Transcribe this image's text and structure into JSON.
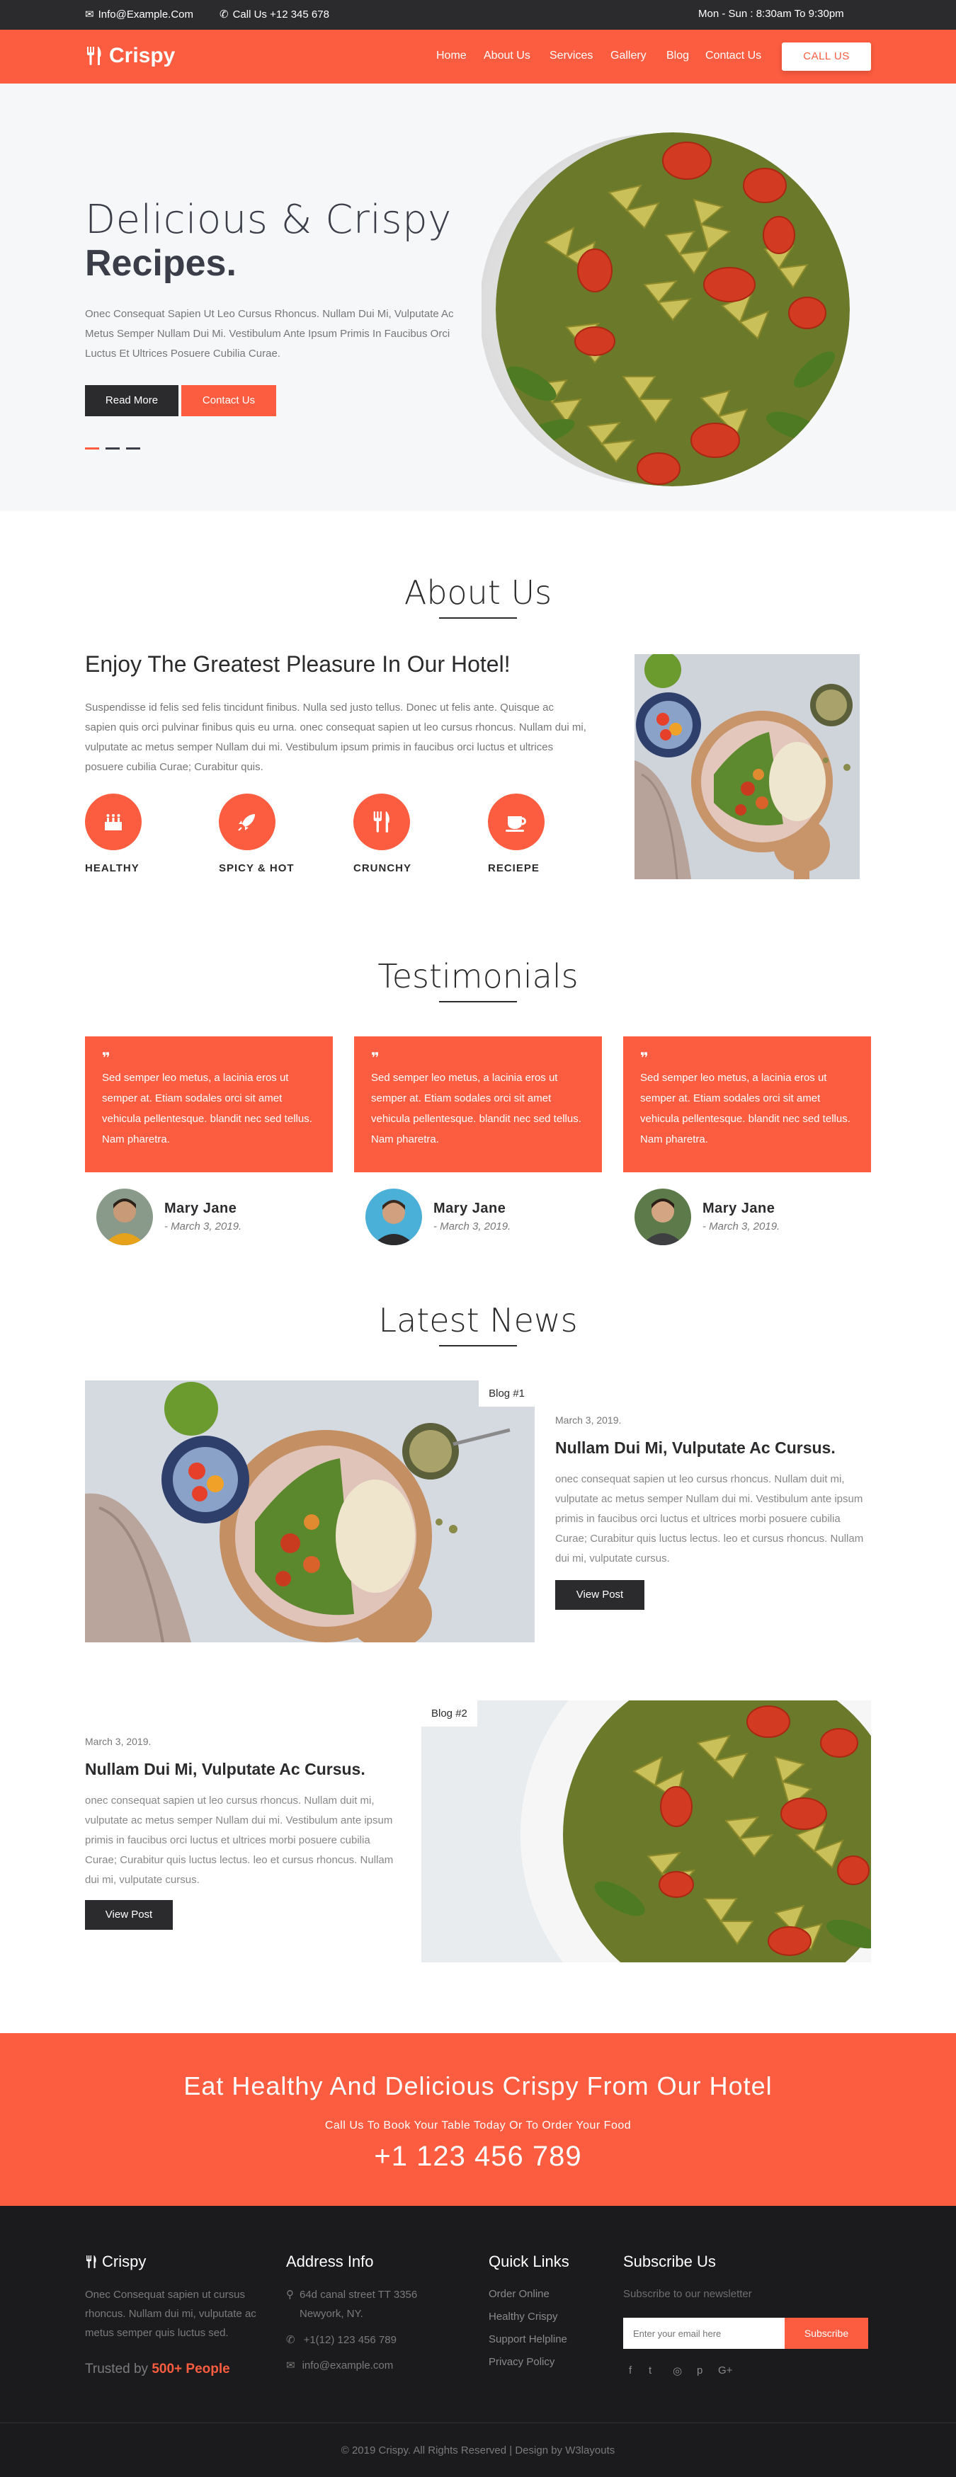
{
  "topbar": {
    "email": "Info@Example.Com",
    "phone": "Call Us +12 345 678",
    "hours": "Mon - Sun : 8:30am To 9:30pm"
  },
  "nav": {
    "logo": "Crispy",
    "links": [
      "Home",
      "About Us",
      "Services",
      "Gallery",
      "Blog",
      "Contact Us"
    ],
    "cta": "CALL US"
  },
  "hero": {
    "title_line1": "Delicious & Crispy",
    "title_line2": "Recipes.",
    "text": "Onec Consequat Sapien Ut Leo Cursus Rhoncus. Nullam Dui Mi, Vulputate Ac Metus Semper Nullam Dui Mi. Vestibulum Ante Ipsum Primis In Faucibus Orci Luctus Et Ultrices Posuere Cubilia Curae.",
    "read_more": "Read More",
    "contact_us": "Contact Us"
  },
  "about": {
    "title": "About Us",
    "subtitle": "Enjoy The Greatest Pleasure In Our Hotel!",
    "text": "Suspendisse id felis sed felis tincidunt finibus. Nulla sed justo tellus. Donec ut felis ante. Quisque ac sapien quis orci pulvinar finibus quis eu urna. onec consequat sapien ut leo cursus rhoncus. Nullam dui mi, vulputate ac metus semper Nullam dui mi. Vestibulum ipsum primis in faucibus orci luctus et ultrices posuere cubilia Curae; Curabitur quis.",
    "features": [
      "HEALTHY",
      "SPICY & HOT",
      "CRUNCHY",
      "RECIEPE"
    ]
  },
  "testimonials": {
    "title": "Testimonials",
    "items": [
      {
        "quote": "Sed semper leo metus, a lacinia eros ut semper at. Etiam sodales orci sit amet vehicula pellentesque. blandit nec sed tellus. Nam pharetra.",
        "name": "Mary Jane",
        "date": "- March 3, 2019."
      },
      {
        "quote": "Sed semper leo metus, a lacinia eros ut semper at. Etiam sodales orci sit amet vehicula pellentesque. blandit nec sed tellus. Nam pharetra.",
        "name": "Mary Jane",
        "date": "- March 3, 2019."
      },
      {
        "quote": "Sed semper leo metus, a lacinia eros ut semper at. Etiam sodales orci sit amet vehicula pellentesque. blandit nec sed tellus. Nam pharetra.",
        "name": "Mary Jane",
        "date": "- March 3, 2019."
      }
    ]
  },
  "news": {
    "title": "Latest News",
    "posts": [
      {
        "tag": "Blog #1",
        "date": "March 3, 2019.",
        "title": "Nullam Dui Mi, Vulputate Ac Cursus.",
        "text": "onec consequat sapien ut leo cursus rhoncus. Nullam duit mi, vulputate ac metus semper Nullam dui mi. Vestibulum ante ipsum primis in faucibus orci luctus et ultrices morbi posuere cubilia Curae; Curabitur quis luctus lectus. leo et cursus rhoncus. Nullam dui mi, vulputate cursus.",
        "button": "View Post"
      },
      {
        "tag": "Blog #2",
        "date": "March 3, 2019.",
        "title": "Nullam Dui Mi, Vulputate Ac Cursus.",
        "text": "onec consequat sapien ut leo cursus rhoncus. Nullam duit mi, vulputate ac metus semper Nullam dui mi. Vestibulum ante ipsum primis in faucibus orci luctus et ultrices morbi posuere cubilia Curae; Curabitur quis luctus lectus. leo et cursus rhoncus. Nullam dui mi, vulputate cursus.",
        "button": "View Post"
      }
    ]
  },
  "cta": {
    "title": "Eat Healthy And Delicious Crispy From Our Hotel",
    "subtitle": "Call Us To Book Your Table Today Or To Order Your Food",
    "phone": "+1 123 456 789"
  },
  "footer": {
    "logo": "Crispy",
    "about_text": "Onec Consequat sapien ut cursus rhoncus. Nullam dui mi, vulputate ac metus semper quis luctus sed.",
    "trusted_prefix": "Trusted by",
    "trusted_count": "500+ People",
    "address_title": "Address Info",
    "address": "64d canal street TT 3356 Newyork, NY.",
    "phone": "+1(12) 123 456 789",
    "email": "info@example.com",
    "links_title": "Quick Links",
    "links": [
      "Order Online",
      "Healthy Crispy",
      "Support Helpline",
      "Privacy Policy"
    ],
    "subscribe_title": "Subscribe Us",
    "subscribe_text": "Subscribe to our newsletter",
    "email_placeholder": "Enter your email here",
    "subscribe_button": "Subscribe",
    "social": [
      "f",
      "t",
      "◎",
      "p",
      "G+"
    ],
    "copyright": "© 2019 Crispy. All Rights Reserved | Design by W3layouts"
  },
  "colors": {
    "accent": "#fc5c3f",
    "dark": "#2b2b2d",
    "footer_bg": "#1b1b1d",
    "hero_bg": "#f6f7f9"
  }
}
